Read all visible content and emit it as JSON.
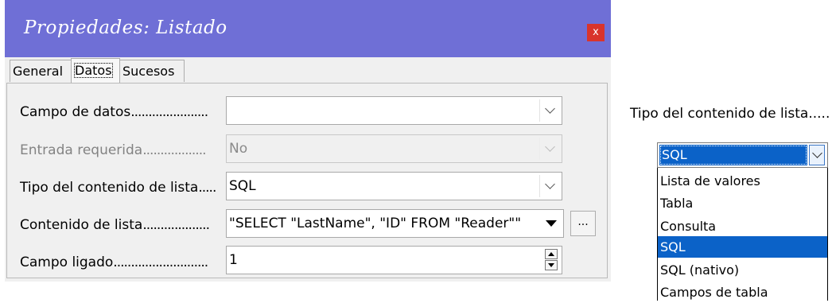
{
  "dialog": {
    "title": "Propiedades: Listado",
    "close_label": "x",
    "tabs": [
      {
        "label": "General"
      },
      {
        "label": "Datos"
      },
      {
        "label": "Sucesos"
      }
    ],
    "fields": {
      "campo_datos": {
        "label": "Campo de datos",
        "dots": "......................",
        "value": ""
      },
      "entrada_requerida": {
        "label": "Entrada requerida",
        "dots": "..................",
        "value": "No"
      },
      "tipo_contenido": {
        "label": "Tipo del contenido de lista",
        "dots": ".....",
        "value": "SQL"
      },
      "contenido_lista": {
        "label": "Contenido de lista",
        "dots": "...................",
        "value": "\"SELECT \"LastName\", \"ID\" FROM \"Reader\"\"",
        "button": "..."
      },
      "campo_ligado": {
        "label": "Campo ligado",
        "dots": "...........................",
        "value": "1"
      }
    }
  },
  "side": {
    "label": "Tipo del contenido de lista.....",
    "combo_value": "SQL",
    "options": [
      "Lista de valores",
      "Tabla",
      "Consulta",
      "SQL",
      "SQL (nativo)",
      "Campos de tabla"
    ],
    "selected_option": "SQL"
  },
  "colors": {
    "titlebar": "#6f6fd6",
    "close": "#d9342b",
    "selection": "#0b62c8"
  }
}
